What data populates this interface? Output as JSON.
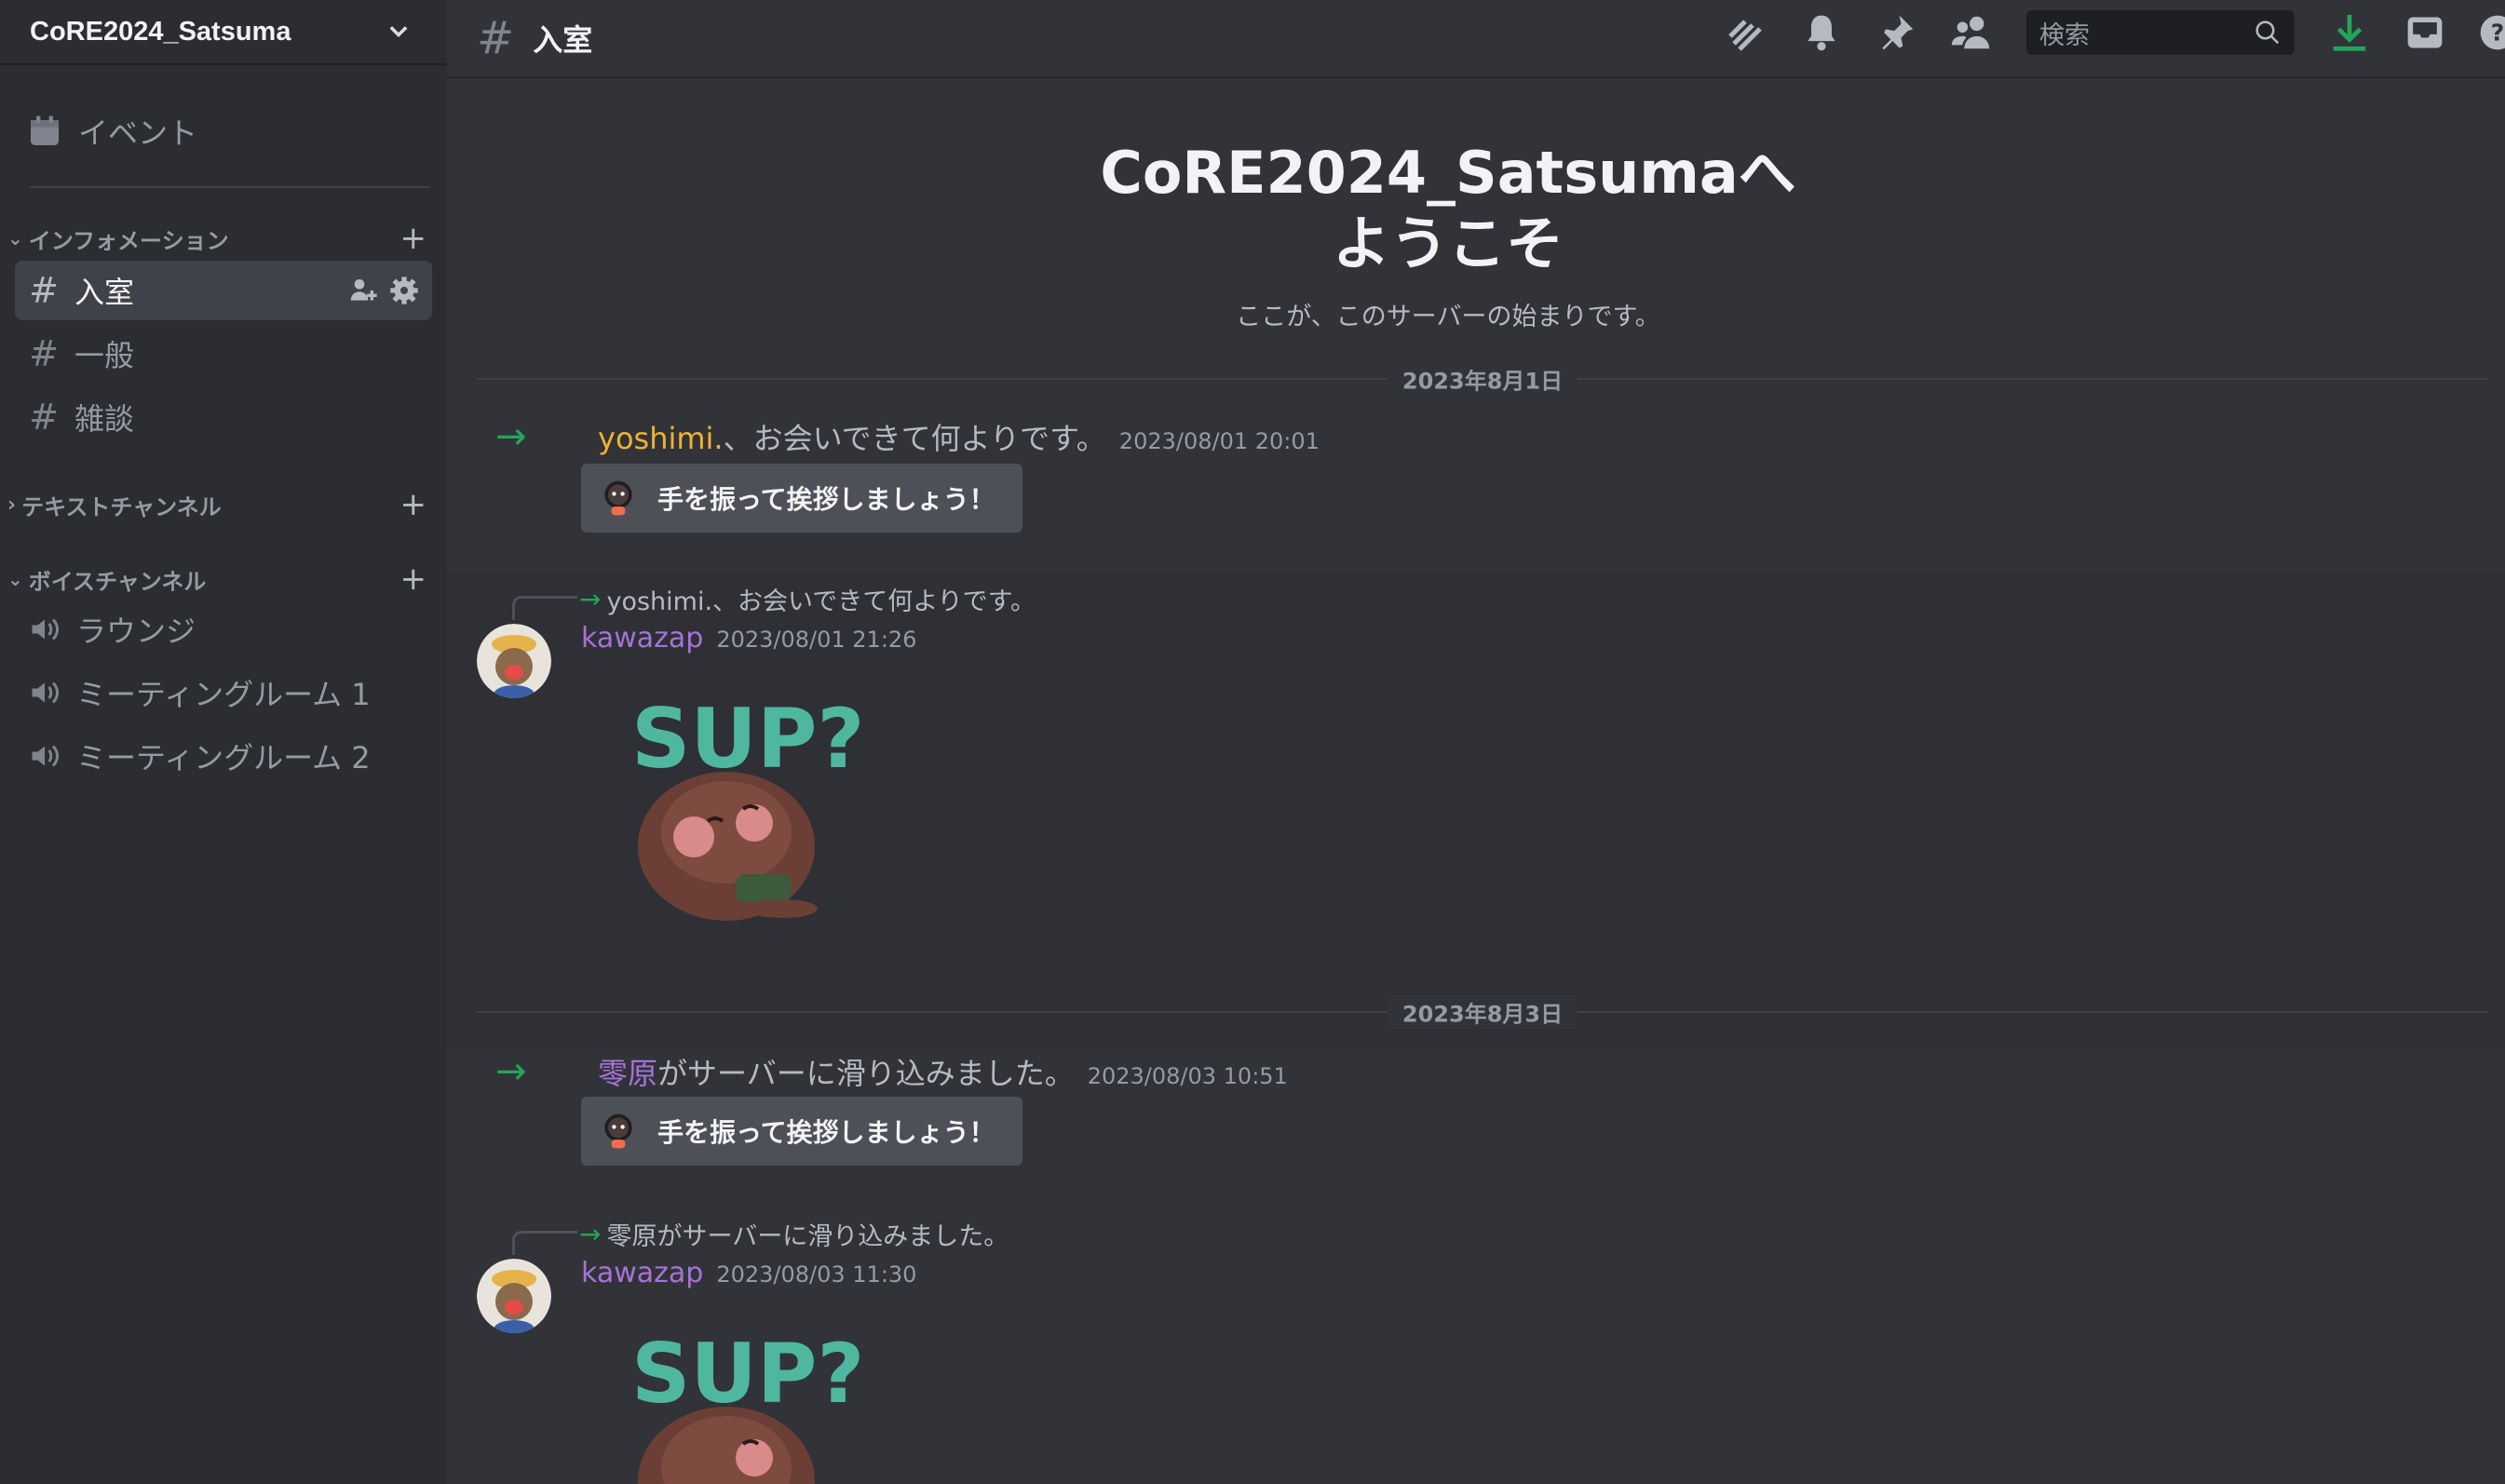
{
  "server": {
    "name": "CoRE2024_Satsuma"
  },
  "sidebar": {
    "event_label": "イベント",
    "categories": [
      {
        "label": "インフォメーション"
      },
      {
        "label": "テキストチャンネル"
      },
      {
        "label": "ボイスチャンネル"
      }
    ],
    "info_channels": [
      {
        "label": "入室"
      },
      {
        "label": "一般"
      },
      {
        "label": "雑談"
      }
    ],
    "voice_channels": [
      {
        "label": "ラウンジ"
      },
      {
        "label": "ミーティングルーム 1"
      },
      {
        "label": "ミーティングルーム 2"
      }
    ]
  },
  "topbar": {
    "channel_name": "入室",
    "search_placeholder": "検索"
  },
  "welcome": {
    "title": "CoRE2024_Satsumaへようこそ",
    "subtitle": "ここが、このサーバーの始まりです。"
  },
  "messages": {
    "date1": "2023年8月1日",
    "join1": {
      "user": "yoshimi.",
      "text": "、お会いできて何よりです。",
      "time": "2023/08/01 20:01"
    },
    "wave_label": "手を振って挨拶しましょう！",
    "reply1": "yoshimi.、お会いできて何よりです。",
    "msg1": {
      "author": "kawazap",
      "time": "2023/08/01 21:26"
    },
    "date2": "2023年8月3日",
    "join2": {
      "user": "零原",
      "text": "がサーバーに滑り込みました。",
      "time": "2023/08/03 10:51"
    },
    "reply2": "零原がサーバーに滑り込みました。",
    "msg2": {
      "author": "kawazap",
      "time": "2023/08/03 11:30"
    },
    "sticker_text": "SUP?"
  },
  "colors": {
    "accent_green": "#23a559",
    "user_yellow": "#f0b232",
    "user_purple": "#a772d8"
  }
}
